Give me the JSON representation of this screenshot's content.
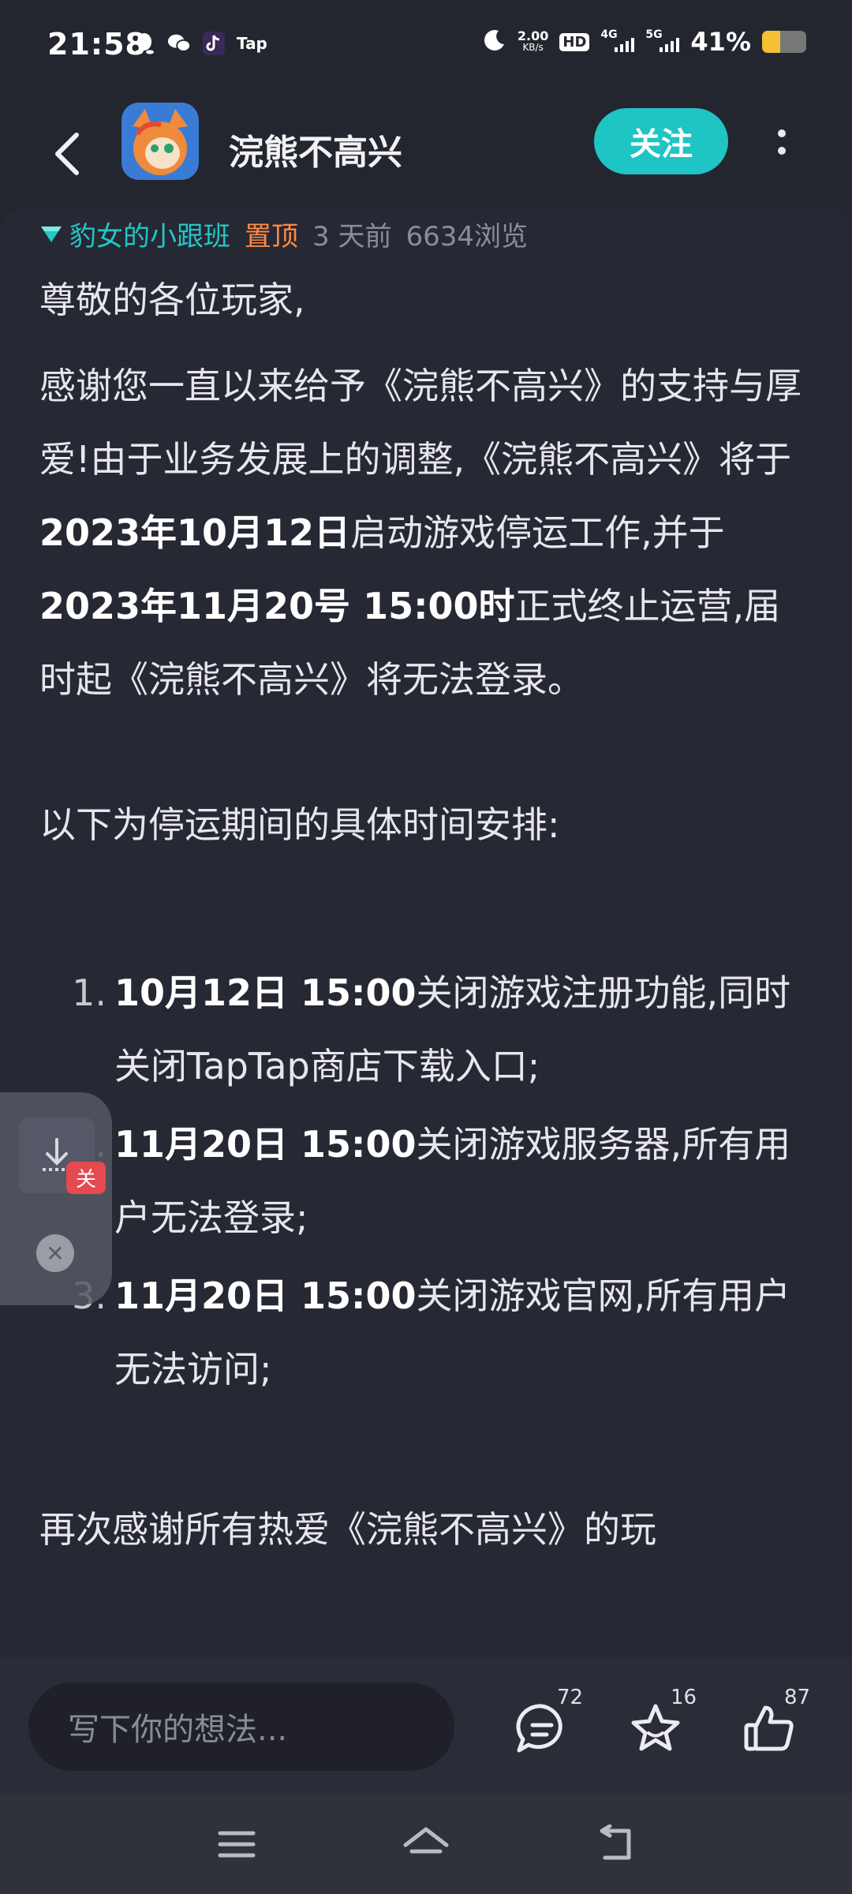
{
  "status_bar": {
    "time": "21:58",
    "app_icons": [
      "qq-icon",
      "wechat-icon",
      "tiktok-icon"
    ],
    "tap_label": "Tap",
    "speed_value": "2.00",
    "speed_unit": "KB/s",
    "hd_label": "HD",
    "net1_label": "4G",
    "net2_label": "5G",
    "battery_percent": "41%",
    "battery_level": 0.41
  },
  "header": {
    "title": "浣熊不高兴",
    "follow_label": "关注"
  },
  "post_meta": {
    "tag": "豹女的小跟班",
    "pinned": "置顶",
    "time_ago": "3 天前",
    "views": "6634浏览"
  },
  "post": {
    "greeting": "尊敬的各位玩家,",
    "p1_a": "感谢您一直以来给予《浣熊不高兴》的支持与厚爱!由于业务发展上的调整,《浣熊不高兴》将于",
    "p1_b": "2023年10月12日",
    "p1_c": "启动游戏停运工作,并于",
    "p1_d": "2023年11月20号 15:00时",
    "p1_e": "正式终止运营,届时起《浣熊不高兴》将无法登录。",
    "schedule_intro": "以下为停运期间的具体时间安排:",
    "items": [
      {
        "num": "1.",
        "bold": "10月12日 15:00",
        "text": "关闭游戏注册功能,同时关闭TapTap商店下载入口;"
      },
      {
        "num": "2.",
        "bold": "11月20日 15:00",
        "text": "关闭游戏服务器,所有用户无法登录;"
      },
      {
        "num": "3.",
        "bold": "11月20日 15:00",
        "text": "关闭游戏官网,所有用户无法访问;"
      }
    ],
    "closing": "再次感谢所有热爱《浣熊不高兴》的玩"
  },
  "floater": {
    "badge": "关"
  },
  "action_bar": {
    "comment_placeholder": "写下你的想法...",
    "comments_count": "72",
    "favorites_count": "16",
    "likes_count": "87"
  },
  "colors": {
    "accent": "#1fc4c4",
    "pinned": "#ff8a45",
    "background": "#24262f"
  }
}
